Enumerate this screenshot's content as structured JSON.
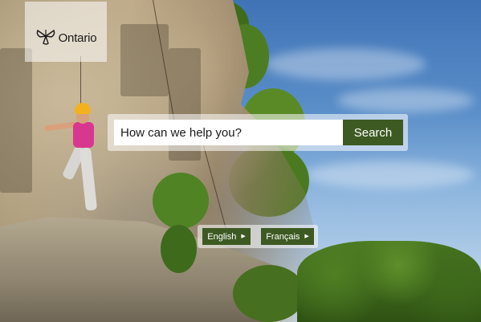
{
  "logo": {
    "text": "Ontario",
    "icon": "trillium-logo-icon"
  },
  "search": {
    "placeholder": "How can we help you?",
    "value": "",
    "button_label": "Search"
  },
  "languages": [
    {
      "label": "English",
      "icon": "chevron-right-icon"
    },
    {
      "label": "Français",
      "icon": "chevron-right-icon"
    }
  ],
  "colors": {
    "accent": "#3d5a22",
    "panel": "rgba(255,255,255,0.55)"
  }
}
